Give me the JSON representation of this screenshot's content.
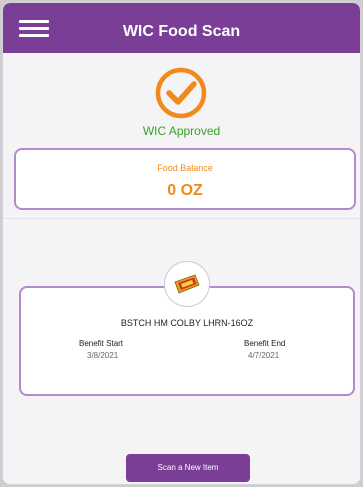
{
  "header": {
    "title": "WIC Food Scan",
    "menu_icon": "hamburger-icon"
  },
  "status": {
    "icon": "check-circle-icon",
    "text": "WIC Approved"
  },
  "balance": {
    "label": "Food Balance",
    "value": "0 OZ"
  },
  "item": {
    "thumbnail": "cheese-package-image",
    "name": "BSTCH HM COLBY LHRN-16OZ",
    "benefit_start_label": "Benefit Start",
    "benefit_start_value": "3/8/2021",
    "benefit_end_label": "Benefit End",
    "benefit_end_value": "4/7/2021"
  },
  "actions": {
    "scan_label": "Scan a New Item"
  },
  "colors": {
    "brand_purple": "#7a3e97",
    "approved_green": "#36a22b",
    "accent_orange": "#f08a1a",
    "card_border": "#b48ac9"
  }
}
